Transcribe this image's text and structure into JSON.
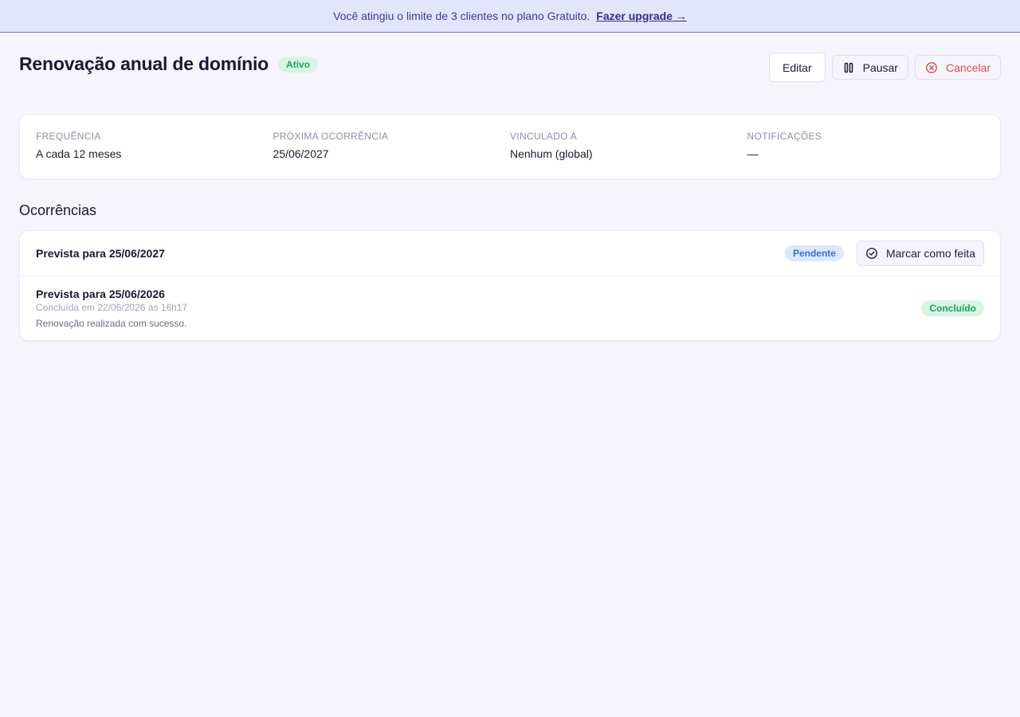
{
  "banner": {
    "message": "Você atingiu o limite de 3 clientes no plano Gratuito.",
    "link_label": "Fazer upgrade →"
  },
  "header": {
    "title": "Renovação anual de domínio",
    "status_badge": "Ativo",
    "actions": {
      "edit_label": "Editar",
      "pause_label": "Pausar",
      "cancel_label": "Cancelar"
    }
  },
  "details": {
    "frequency": {
      "label": "Frequência",
      "value": "A cada 12 meses"
    },
    "next_occurrence": {
      "label": "Próxima ocorrência",
      "value": "25/06/2027"
    },
    "linked_to": {
      "label": "Vinculado a",
      "value": "Nenhum (global)"
    },
    "notifications": {
      "label": "Notificações",
      "value": "—"
    }
  },
  "occurrences": {
    "title": "Ocorrências",
    "items": [
      {
        "title": "Prevista para 25/06/2027",
        "status": "Pendente",
        "action_label": "Marcar como feita"
      },
      {
        "title": "Prevista para 25/06/2026",
        "completed_at": "Concluída em 22/06/2026 às 16h17",
        "note": "Renovação realizada com sucesso.",
        "status": "Concluído"
      }
    ]
  },
  "colors": {
    "accent": "#3b3b9a",
    "danger": "#e5484d",
    "success": "#1fa35e",
    "pending": "#3a73d1"
  }
}
